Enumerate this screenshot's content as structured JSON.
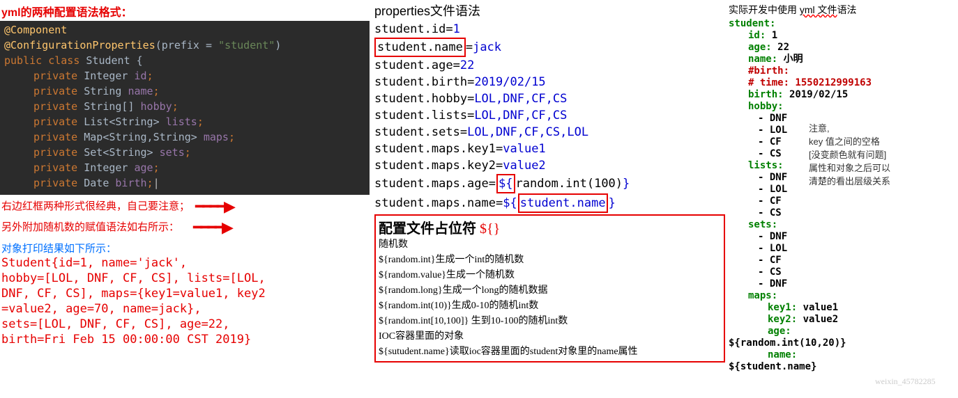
{
  "col1": {
    "title": "yml的两种配置语法格式：",
    "code": {
      "l1_ann": "@Component",
      "l2_ann": "@ConfigurationProperties",
      "l2_pre": "(prefix = ",
      "l2_str": "\"student\"",
      "l2_end": ")",
      "l3_a": "public class ",
      "l3_b": "Student ",
      "l3_c": "{",
      "l4_a": "private ",
      "l4_b": "Integer ",
      "l4_c": "id",
      "l4_d": ";",
      "l5_a": "private ",
      "l5_b": "String ",
      "l5_c": "name",
      "l5_d": ";",
      "l6_a": "private ",
      "l6_b": "String[] ",
      "l6_c": "hobby",
      "l6_d": ";",
      "l7_a": "private ",
      "l7_b": "List<String> ",
      "l7_c": "lists",
      "l7_d": ";",
      "l8_a": "private ",
      "l8_b": "Map<String,String> ",
      "l8_c": "maps",
      "l8_d": ";",
      "l9_a": "private ",
      "l9_b": "Set<String> ",
      "l9_c": "sets",
      "l9_d": ";",
      "l10_a": "private ",
      "l10_b": "Integer ",
      "l10_c": "age",
      "l10_d": ";",
      "l11_a": "private ",
      "l11_b": "Date ",
      "l11_c": "birth",
      "l11_d": ";"
    },
    "note1": "右边红框两种形式很经典，自己要注意；",
    "note2": "另外附加随机数的赋值语法如右所示：",
    "arrow": "━━━━▶",
    "result_title": "对象打印结果如下所示：",
    "out1": "Student{id=1, name='jack',",
    "out2": "hobby=[LOL, DNF, CF, CS], lists=[LOL,",
    "out3": "DNF, CF, CS], maps={key1=value1, key2",
    "out4": "=value2, age=70, name=jack},",
    "out5": "sets=[LOL, DNF, CF, CS], age=22,",
    "out6": "birth=Fri Feb 15 00:00:00 CST 2019}"
  },
  "col2": {
    "title": "properties文件语法",
    "p1_k": "student.id",
    "p1_v": "1",
    "p2_k": "student.name",
    "p2_v": "jack",
    "p3_k": "student.age",
    "p3_v": "22",
    "p4_k": "student.birth",
    "p4_v": "2019/02/15",
    "p5_k": "student.hobby",
    "p5_v": "LOL,DNF,CF,CS",
    "p6_k": "student.lists",
    "p6_v": "LOL,DNF,CF,CS",
    "p7_k": "student.sets",
    "p7_v": "LOL,DNF,CF,CS,LOL",
    "p8_k": "student.maps.key1",
    "p8_v": "value1",
    "p9_k": "student.maps.key2",
    "p9_v": "value2",
    "p10_k": "student.maps.age",
    "p10_a": "${",
    "p10_b": "random.int(100)",
    "p10_c": "}",
    "p11_k": "student.maps.name",
    "p11_a": "${",
    "p11_b": "student.name",
    "p11_c": "}",
    "ph_title": "配置文件占位符",
    "ph_mark": "${}",
    "ph_l1": "随机数",
    "ph_l2": "${random.int}生成一个int的随机数",
    "ph_l3": "${random.value}生成一个随机数",
    "ph_l4": "${random.long}生成一个long的随机数据",
    "ph_l5": "${random.int(10)}生成0-10的随机int数",
    "ph_l6": "${random.int[10,100]} 生到10-100的随机int数",
    "ph_l7": "IOC容器里面的对象",
    "ph_l8": "${sutudent.name}读取ioc容器里面的student对象里的name属性"
  },
  "col3": {
    "title_a": "实际开发中使用 ",
    "title_b": "yml 文件",
    "title_c": "语法",
    "y1": "student:",
    "y2k": "id:",
    "y2v": " 1",
    "y3k": "age:",
    "y3v": " 22",
    "y4k": "name:",
    "y4v": " 小明",
    "y5": "#birth:",
    "y6": "#  time: 1550212999163",
    "y7k": "birth:",
    "y7v": " 2019/02/15",
    "y8": "hobby:",
    "y8a": "- DNF",
    "y8b": "- LOL",
    "y8c": "- CF",
    "y8d": "- CS",
    "y9": "lists:",
    "y9a": "- DNF",
    "y9b": "- LOL",
    "y9c": "- CF",
    "y9d": "- CS",
    "y10": "sets:",
    "y10a": "- DNF",
    "y10b": "- LOL",
    "y10c": "- CF",
    "y10d": "- CS",
    "y10e": "- DNF",
    "y11": "maps:",
    "y11a_k": "key1:",
    "y11a_v": " value1",
    "y11b_k": "key2:",
    "y11b_v": " value2",
    "y11c": "age:",
    "f1": "${random.int(10,20)}",
    "y11d": "name:",
    "f2": "${student.name}",
    "note": "注意,\nkey 值之间的空格\n[没变颜色就有问题]\n属性和对象之后可以\n清楚的看出层级关系"
  },
  "watermark": "weixin_45782285"
}
